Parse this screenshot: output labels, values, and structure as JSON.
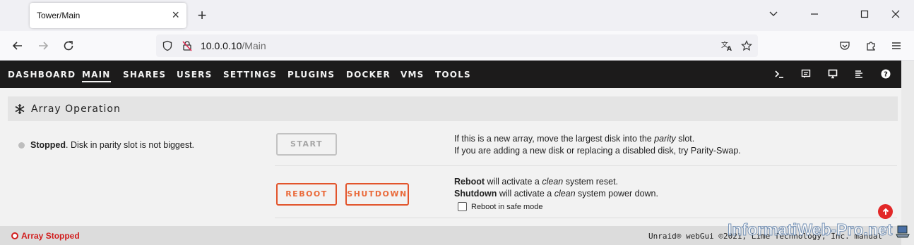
{
  "browser": {
    "tab_title": "Tower/Main",
    "url_host": "10.0.0.10",
    "url_path": "/Main"
  },
  "menu": {
    "items": [
      "DASHBOARD",
      "MAIN",
      "SHARES",
      "USERS",
      "SETTINGS",
      "PLUGINS",
      "DOCKER",
      "VMS",
      "TOOLS"
    ],
    "active": "MAIN"
  },
  "section": {
    "title": "Array Operation"
  },
  "status": {
    "label": "Stopped",
    "message": ". Disk in parity slot is not biggest."
  },
  "buttons": {
    "start": "START",
    "reboot": "REBOOT",
    "shutdown": "SHUTDOWN"
  },
  "info": {
    "line1_pre": "If this is a new array, move the largest disk into the ",
    "line1_em": "parity",
    "line1_post": " slot.",
    "line2": "If you are adding a new disk or replacing a disabled disk, try Parity-Swap.",
    "reboot_bold": "Reboot",
    "reboot_pre": " will activate a ",
    "reboot_em": "clean",
    "reboot_post": " system reset.",
    "shutdown_bold": "Shutdown",
    "shutdown_pre": " will activate a ",
    "shutdown_em": "clean",
    "shutdown_post": " system power down.",
    "safe_mode_label": "Reboot in safe mode"
  },
  "footer": {
    "status": "Array Stopped",
    "copyright": "Unraid® webGui ©2021, Lime Technology, Inc. manual"
  },
  "watermark": "InformatiWeb-Pro.net",
  "colors": {
    "nav_bg": "#1c1b1b",
    "accent_orange": "#e2542b",
    "stopped_red": "#d11d1d"
  },
  "icons": [
    "close-icon",
    "plus-icon",
    "back-icon",
    "forward-icon",
    "reload-icon",
    "shield-icon",
    "insecure-lock-icon",
    "translate-icon",
    "star-icon",
    "pocket-icon",
    "extensions-icon",
    "hamburger-icon",
    "terminal-icon",
    "feedback-icon",
    "monitor-icon",
    "log-icon",
    "help-icon",
    "snowflake-icon",
    "arrow-up-icon"
  ]
}
